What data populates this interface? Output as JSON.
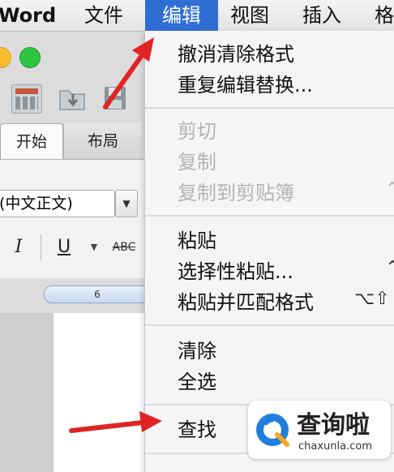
{
  "menubar": {
    "app_name": "Word",
    "items": [
      "文件",
      "编辑",
      "视图",
      "插入",
      "格"
    ],
    "active_index": 1
  },
  "window": {
    "tabs": [
      "开始",
      "布局"
    ],
    "font_name": "(中文正文)",
    "format_buttons": {
      "italic": "I",
      "underline": "U",
      "strike": "ABC"
    },
    "ruler_label": "6"
  },
  "edit_menu": {
    "groups": [
      [
        {
          "label": "撤消清除格式",
          "enabled": true
        },
        {
          "label": "重复编辑替换...",
          "enabled": true
        }
      ],
      [
        {
          "label": "剪切",
          "enabled": false
        },
        {
          "label": "复制",
          "enabled": false
        },
        {
          "label": "复制到剪贴簿",
          "enabled": false
        }
      ],
      [
        {
          "label": "粘贴",
          "enabled": true
        },
        {
          "label": "选择性粘贴...",
          "enabled": true
        },
        {
          "label": "粘贴并匹配格式",
          "enabled": true
        }
      ],
      [
        {
          "label": "清除",
          "enabled": true
        },
        {
          "label": "全选",
          "enabled": true
        }
      ],
      [
        {
          "label": "查找",
          "enabled": true
        }
      ]
    ],
    "shortcut_paste_match": "⌥⇧",
    "shortcut_copy_scrap": "⌃",
    "shortcut_paste_special": "⌃"
  },
  "watermark": {
    "name": "查询啦",
    "domain": "chaxunla.com"
  },
  "colors": {
    "menu_highlight": "#2f6fd4",
    "annotation_arrow": "#e02424",
    "logo_blue": "#1e7fe0"
  }
}
